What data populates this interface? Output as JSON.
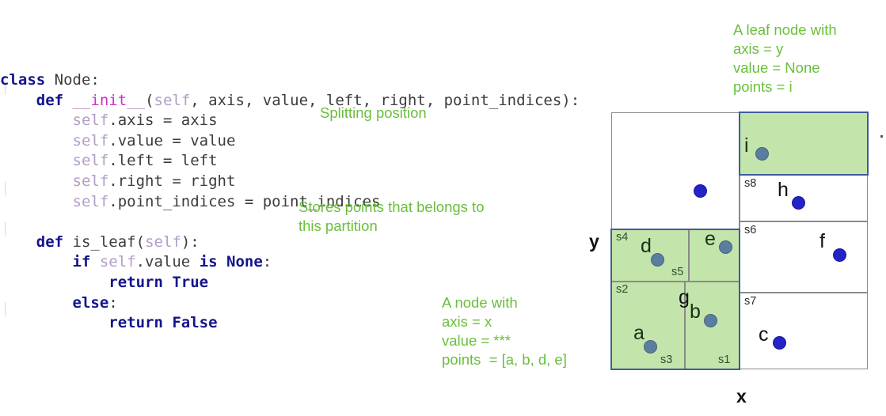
{
  "code": {
    "language": "python",
    "lines": [
      [
        {
          "t": "class ",
          "c": "kw"
        },
        {
          "t": "Node",
          "c": "plain"
        },
        {
          "t": ":",
          "c": "punct"
        }
      ],
      [
        {
          "t": "    ",
          "c": "plain"
        },
        {
          "t": "def ",
          "c": "kw"
        },
        {
          "t": "__",
          "c": "und"
        },
        {
          "t": "init",
          "c": "fn"
        },
        {
          "t": "__",
          "c": "und"
        },
        {
          "t": "(",
          "c": "punct"
        },
        {
          "t": "self",
          "c": "self"
        },
        {
          "t": ", axis, value, left, right, point_indices):",
          "c": "plain"
        }
      ],
      [
        {
          "t": "        ",
          "c": "plain"
        },
        {
          "t": "self",
          "c": "self"
        },
        {
          "t": ".axis = axis",
          "c": "plain"
        }
      ],
      [
        {
          "t": "        ",
          "c": "plain"
        },
        {
          "t": "self",
          "c": "self"
        },
        {
          "t": ".value = value",
          "c": "plain"
        }
      ],
      [
        {
          "t": "        ",
          "c": "plain"
        },
        {
          "t": "self",
          "c": "self"
        },
        {
          "t": ".left = left",
          "c": "plain"
        }
      ],
      [
        {
          "t": "        ",
          "c": "plain"
        },
        {
          "t": "self",
          "c": "self"
        },
        {
          "t": ".right = right",
          "c": "plain"
        }
      ],
      [
        {
          "t": "        ",
          "c": "plain"
        },
        {
          "t": "self",
          "c": "self"
        },
        {
          "t": ".point_indices = point_indices",
          "c": "plain"
        }
      ],
      [
        {
          "t": "",
          "c": "plain"
        }
      ],
      [
        {
          "t": "    ",
          "c": "plain"
        },
        {
          "t": "def ",
          "c": "kw"
        },
        {
          "t": "is_leaf",
          "c": "plain"
        },
        {
          "t": "(",
          "c": "punct"
        },
        {
          "t": "self",
          "c": "self"
        },
        {
          "t": "):",
          "c": "punct"
        }
      ],
      [
        {
          "t": "        ",
          "c": "plain"
        },
        {
          "t": "if ",
          "c": "kw"
        },
        {
          "t": "self",
          "c": "self"
        },
        {
          "t": ".value ",
          "c": "plain"
        },
        {
          "t": "is None",
          "c": "kw"
        },
        {
          "t": ":",
          "c": "punct"
        }
      ],
      [
        {
          "t": "            ",
          "c": "plain"
        },
        {
          "t": "return True",
          "c": "kw"
        }
      ],
      [
        {
          "t": "        ",
          "c": "plain"
        },
        {
          "t": "else",
          "c": "kw"
        },
        {
          "t": ":",
          "c": "punct"
        }
      ],
      [
        {
          "t": "            ",
          "c": "plain"
        },
        {
          "t": "return False",
          "c": "kw"
        }
      ]
    ]
  },
  "annotations": {
    "splitting_position": "Splitting position",
    "stores_points": "Stores points that belongs to\nthis partition",
    "node_description": "A node with\naxis = x\nvalue = ***\npoints  = [a, b, d, e]",
    "leaf_description": "A leaf node with\naxis = y\nvalue = None\npoints = i"
  },
  "diagram": {
    "axis_x_label": "x",
    "axis_y_label": "y",
    "region_labels": [
      "s4",
      "s5",
      "s2",
      "s3",
      "s1",
      "s8",
      "s6",
      "s7"
    ],
    "points": [
      {
        "id": "a",
        "highlighted": true
      },
      {
        "id": "b",
        "highlighted": true
      },
      {
        "id": "c",
        "highlighted": false
      },
      {
        "id": "d",
        "highlighted": true
      },
      {
        "id": "e",
        "highlighted": true
      },
      {
        "id": "f",
        "highlighted": false
      },
      {
        "id": "g",
        "highlighted": false
      },
      {
        "id": "h",
        "highlighted": false
      },
      {
        "id": "i",
        "highlighted": true
      }
    ]
  },
  "colors": {
    "annotation_green": "#6abf3c",
    "region_fill_green": "#c3e5ac",
    "highlight_border_blue": "#3f5c9c",
    "point_blue": "#2323c8",
    "point_blue_on_green": "#5b7ea0",
    "cell_border_gray": "#8a8a8a",
    "keyword_navy": "#14148c",
    "function_magenta": "#c832c8",
    "self_mauve": "#b39dc4"
  }
}
